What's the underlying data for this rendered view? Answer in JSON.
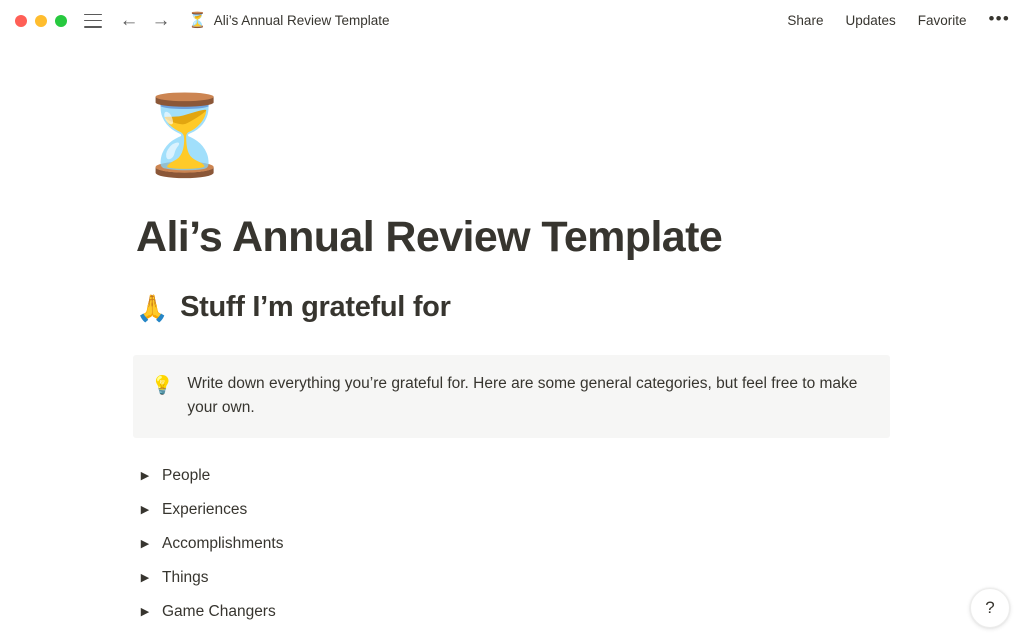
{
  "window": {
    "traffic_lights": [
      {
        "name": "close",
        "color": "#FF5F56"
      },
      {
        "name": "minimize",
        "color": "#FFBD2E"
      },
      {
        "name": "maximize",
        "color": "#27C93F"
      }
    ],
    "menu_icon": "hamburger-menu-icon",
    "back_glyph": "←",
    "forward_glyph": "→",
    "tab_emoji": "⏳",
    "tab_title": "Ali’s Annual Review Template",
    "actions": [
      {
        "label": "Share"
      },
      {
        "label": "Updates"
      },
      {
        "label": "Favorite"
      }
    ],
    "more_glyph": "•••"
  },
  "page": {
    "emoji": "⏳",
    "title": "Ali’s Annual Review Template",
    "section": {
      "emoji": "🙏",
      "heading": "Stuff I’m grateful for"
    },
    "callout": {
      "icon": "💡",
      "text": "Write down everything you’re grateful for. Here are some general categories, but feel free to make your own.",
      "background_color": "#F6F6F5"
    },
    "toggles": [
      {
        "arrow": "▶",
        "label": "People"
      },
      {
        "arrow": "▶",
        "label": "Experiences"
      },
      {
        "arrow": "▶",
        "label": "Accomplishments"
      },
      {
        "arrow": "▶",
        "label": "Things"
      },
      {
        "arrow": "▶",
        "label": "Game Changers"
      }
    ]
  },
  "help_button": {
    "glyph": "?"
  },
  "colors": {
    "text": "#37352F",
    "page_background": "#FFFFFF"
  }
}
